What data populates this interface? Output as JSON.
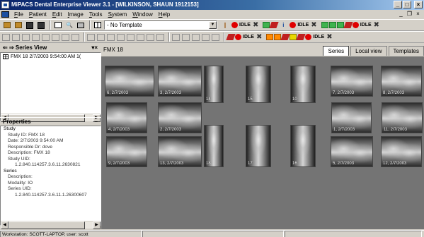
{
  "window": {
    "title": "MiPACS Dental Enterprise Viewer 3.1 - [WILKINSON, SHAUN  1912153]",
    "minimize": "_",
    "maximize": "□",
    "close": "×",
    "mdi_minimize": "_",
    "mdi_restore": "❐",
    "mdi_close": "×"
  },
  "menu": [
    {
      "label": "File"
    },
    {
      "label": "Patient"
    },
    {
      "label": "Edit"
    },
    {
      "label": "Image"
    },
    {
      "label": "Tools"
    },
    {
      "label": "System"
    },
    {
      "label": "Window"
    },
    {
      "label": "Help"
    }
  ],
  "toolbar": {
    "template_value": "- No Template",
    "idle1": "IDLE",
    "idle2": "IDLE",
    "idle3": "IDLE",
    "idle4": "IDLE",
    "idle5": "IDLE"
  },
  "series_view": {
    "title": "Series View",
    "close": "▾×",
    "rows": [
      {
        "label": "FMX 18   2/7/2003 9:54:00 AM    1("
      }
    ]
  },
  "properties": {
    "title": "Properties",
    "close": "–",
    "rows": [
      {
        "text": "Study",
        "level": 0
      },
      {
        "text": "Study ID: FMX 18",
        "level": 1
      },
      {
        "text": "Date: 2/7/2003 9:54:00 AM",
        "level": 1
      },
      {
        "text": "Responsible Dr: dove",
        "level": 1
      },
      {
        "text": "Description: FMX 18",
        "level": 1
      },
      {
        "text": "Study UID:",
        "level": 1
      },
      {
        "text": "1.2.840.114257.3.6.11.2630821",
        "level": 2
      },
      {
        "text": "Series",
        "level": 0
      },
      {
        "text": "Description:",
        "level": 1
      },
      {
        "text": "Modality: IO",
        "level": 1
      },
      {
        "text": "Series UID:",
        "level": 1
      },
      {
        "text": "1.2.840.114257.3.6.11.1.26300607",
        "level": 2
      }
    ]
  },
  "main": {
    "title": "FMX 18",
    "tabs": [
      {
        "label": "Series",
        "active": true
      },
      {
        "label": "Local view",
        "active": false
      },
      {
        "label": "Templates",
        "active": false
      }
    ]
  },
  "xrays": [
    {
      "caption": "6, 2/7/2003"
    },
    {
      "caption": "3, 2/7/2003"
    },
    {
      "caption": "14"
    },
    {
      "caption": "15"
    },
    {
      "caption": "10"
    },
    {
      "caption": "7, 2/7/2003"
    },
    {
      "caption": "8, 2/7/2003"
    },
    {
      "caption": "4, 2/7/2003"
    },
    {
      "caption": "2, 2/7/2003"
    },
    {
      "caption": "1, 2/7/2003"
    },
    {
      "caption": "11, 2/7/2003"
    },
    {
      "caption": "9, 2/7/2003"
    },
    {
      "caption": "13, 2/7/2003"
    },
    {
      "caption": "18"
    },
    {
      "caption": "17"
    },
    {
      "caption": "16"
    },
    {
      "caption": "5, 2/7/2003"
    },
    {
      "caption": "12, 2/7/2003"
    }
  ],
  "status": {
    "workstation": "Workstation: SCOTT-LAPTOP, user: scott"
  }
}
